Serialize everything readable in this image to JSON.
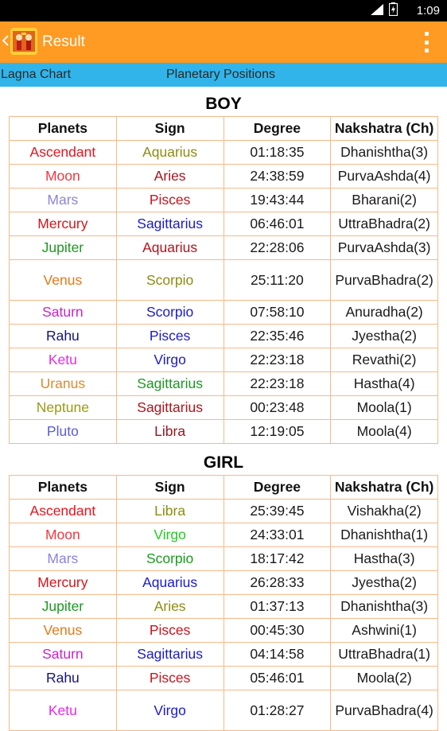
{
  "status_bar": {
    "time": "1:09"
  },
  "app_bar": {
    "title": "Result",
    "back_icon": "chevron-left-icon",
    "logo_icon": "app-logo-icon",
    "menu_icon": "overflow-menu-icon"
  },
  "tabs": [
    {
      "label": "Lagna Chart"
    },
    {
      "label": "Planetary Positions"
    }
  ],
  "boy": {
    "title": "BOY",
    "headers": [
      "Planets",
      "Sign",
      "Degree",
      "Nakshatra (Ch)"
    ],
    "rows": [
      {
        "planet": "Ascendant",
        "planet_color": "#e8141e",
        "sign": "Aquarius",
        "sign_color": "#8c8c10",
        "degree": "01:18:35",
        "nakshatra": "Dhanishtha(3)"
      },
      {
        "planet": "Moon",
        "planet_color": "#f2383f",
        "sign": "Aries",
        "sign_color": "#a51420",
        "degree": "24:38:59",
        "nakshatra": "PurvaAshda(4)"
      },
      {
        "planet": "Mars",
        "planet_color": "#8a84dd",
        "sign": "Pisces",
        "sign_color": "#c8141e",
        "degree": "19:43:44",
        "nakshatra": "Bharani(2)"
      },
      {
        "planet": "Mercury",
        "planet_color": "#d6141c",
        "sign": "Sagittarius",
        "sign_color": "#1a1ad2",
        "degree": "06:46:01",
        "nakshatra": "UttraBhadra(2)"
      },
      {
        "planet": "Jupiter",
        "planet_color": "#1c9a20",
        "sign": "Aquarius",
        "sign_color": "#b3131c",
        "degree": "22:28:06",
        "nakshatra": "PurvaAshda(3)"
      },
      {
        "planet": "Venus",
        "planet_color": "#e07a1a",
        "sign": "Scorpio",
        "sign_color": "#8c8c10",
        "degree": "25:11:20",
        "nakshatra": "PurvaBhadra(2)",
        "tall": true
      },
      {
        "planet": "Saturn",
        "planet_color": "#cc22cc",
        "sign": "Scorpio",
        "sign_color": "#1a1ad2",
        "degree": "07:58:10",
        "nakshatra": "Anuradha(2)"
      },
      {
        "planet": "Rahu",
        "planet_color": "#15157a",
        "sign": "Pisces",
        "sign_color": "#1a1ad2",
        "degree": "22:35:46",
        "nakshatra": "Jyestha(2)"
      },
      {
        "planet": "Ketu",
        "planet_color": "#e82ae8",
        "sign": "Virgo",
        "sign_color": "#1a1ad2",
        "degree": "22:23:18",
        "nakshatra": "Revathi(2)"
      },
      {
        "planet": "Uranus",
        "planet_color": "#e08a2a",
        "sign": "Sagittarius",
        "sign_color": "#1a9a20",
        "degree": "22:23:18",
        "nakshatra": "Hastha(4)"
      },
      {
        "planet": "Neptune",
        "planet_color": "#9a9a12",
        "sign": "Sagittarius",
        "sign_color": "#b3131c",
        "degree": "00:23:48",
        "nakshatra": "Moola(1)"
      },
      {
        "planet": "Pluto",
        "planet_color": "#5a5ae0",
        "sign": "Libra",
        "sign_color": "#9a1420",
        "degree": "12:19:05",
        "nakshatra": "Moola(4)"
      }
    ]
  },
  "girl": {
    "title": "GIRL",
    "headers": [
      "Planets",
      "Sign",
      "Degree",
      "Nakshatra (Ch)"
    ],
    "rows": [
      {
        "planet": "Ascendant",
        "planet_color": "#e8141e",
        "sign": "Libra",
        "sign_color": "#8c8c10",
        "degree": "25:39:45",
        "nakshatra": "Vishakha(2)"
      },
      {
        "planet": "Moon",
        "planet_color": "#f2383f",
        "sign": "Virgo",
        "sign_color": "#22cc22",
        "degree": "24:33:01",
        "nakshatra": "Dhanishtha(1)"
      },
      {
        "planet": "Mars",
        "planet_color": "#8a84dd",
        "sign": "Scorpio",
        "sign_color": "#1a9a20",
        "degree": "18:17:42",
        "nakshatra": "Hastha(3)"
      },
      {
        "planet": "Mercury",
        "planet_color": "#d6141c",
        "sign": "Aquarius",
        "sign_color": "#1a1ad2",
        "degree": "26:28:33",
        "nakshatra": "Jyestha(2)"
      },
      {
        "planet": "Jupiter",
        "planet_color": "#1c9a20",
        "sign": "Aries",
        "sign_color": "#8c8c10",
        "degree": "01:37:13",
        "nakshatra": "Dhanishtha(3)"
      },
      {
        "planet": "Venus",
        "planet_color": "#e07a1a",
        "sign": "Pisces",
        "sign_color": "#c8141e",
        "degree": "00:45:30",
        "nakshatra": "Ashwini(1)"
      },
      {
        "planet": "Saturn",
        "planet_color": "#cc22cc",
        "sign": "Sagittarius",
        "sign_color": "#1a1ad2",
        "degree": "04:14:58",
        "nakshatra": "UttraBhadra(1)"
      },
      {
        "planet": "Rahu",
        "planet_color": "#15157a",
        "sign": "Pisces",
        "sign_color": "#c8141e",
        "degree": "05:46:01",
        "nakshatra": "Moola(2)"
      },
      {
        "planet": "Ketu",
        "planet_color": "#e82ae8",
        "sign": "Virgo",
        "sign_color": "#1a1ad2",
        "degree": "01:28:27",
        "nakshatra": "PurvaBhadra(4)",
        "tall": true
      }
    ]
  }
}
